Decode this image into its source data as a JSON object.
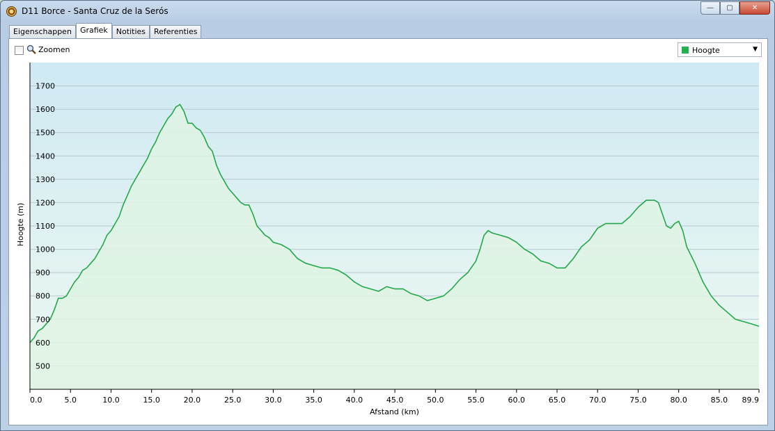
{
  "window": {
    "title": "D11 Borce - Santa Cruz de la Serós"
  },
  "window_buttons": {
    "minimize": "—",
    "maximize": "▢",
    "close": "✕"
  },
  "tabs": [
    {
      "label": "Eigenschappen",
      "active": false
    },
    {
      "label": "Grafiek",
      "active": true
    },
    {
      "label": "Notities",
      "active": false
    },
    {
      "label": "Referenties",
      "active": false
    }
  ],
  "toolbar": {
    "zoom_label": "Zoomen",
    "zoom_checked": false
  },
  "series_select": {
    "value": "Hoogte",
    "swatch_color": "#22b14c"
  },
  "colors": {
    "line": "#22a848",
    "fill": "#dff3e4",
    "bg_top": "#cfe9f3",
    "bg_bottom": "#eef9f1"
  },
  "chart_data": {
    "type": "area",
    "xlabel": "Afstand  (km)",
    "ylabel": "Hoogte (m)",
    "xlim": [
      0,
      89.9
    ],
    "ylim": [
      400,
      1800
    ],
    "x_ticks": [
      "0.0",
      "5.0",
      "10.0",
      "15.0",
      "20.0",
      "25.0",
      "30.0",
      "35.0",
      "40.0",
      "45.0",
      "50.0",
      "55.0",
      "60.0",
      "65.0",
      "70.0",
      "75.0",
      "80.0",
      "85.0",
      "89.9"
    ],
    "y_ticks": [
      "500",
      "600",
      "700",
      "800",
      "900",
      "1000",
      "1100",
      "1200",
      "1300",
      "1400",
      "1500",
      "1600",
      "1700"
    ],
    "grid": true,
    "series": [
      {
        "name": "Hoogte",
        "x": [
          0,
          0.5,
          1,
          1.5,
          2,
          2.5,
          3,
          3.5,
          4,
          4.5,
          5,
          5.5,
          6,
          6.5,
          7,
          7.5,
          8,
          8.5,
          9,
          9.5,
          10,
          10.5,
          11,
          11.5,
          12,
          12.5,
          13,
          13.5,
          14,
          14.5,
          15,
          15.5,
          16,
          16.5,
          17,
          17.5,
          18,
          18.5,
          19,
          19.2,
          19.5,
          20,
          20.5,
          21,
          21.5,
          22,
          22.5,
          23,
          23.5,
          24,
          24.5,
          25,
          25.5,
          26,
          26.5,
          27,
          27.5,
          28,
          28.5,
          29,
          29.5,
          30,
          31,
          32,
          33,
          33.5,
          34,
          35,
          36,
          37,
          38,
          39,
          40,
          41,
          42,
          43,
          44,
          45,
          46,
          47,
          48,
          49,
          50,
          51,
          52,
          53,
          54,
          55,
          55.5,
          56,
          56.5,
          57,
          58,
          59,
          60,
          61,
          62,
          63,
          64,
          65,
          66,
          67,
          68,
          69,
          70,
          71,
          72,
          73,
          74,
          75,
          76,
          77,
          77.5,
          78,
          78.5,
          79,
          79.5,
          80,
          80.5,
          81,
          82,
          83,
          84,
          85,
          86,
          87,
          88,
          89,
          89.9
        ],
        "y": [
          600,
          620,
          650,
          660,
          680,
          700,
          740,
          790,
          790,
          800,
          830,
          860,
          880,
          910,
          920,
          940,
          960,
          990,
          1020,
          1060,
          1080,
          1110,
          1140,
          1190,
          1230,
          1270,
          1300,
          1330,
          1360,
          1390,
          1430,
          1460,
          1500,
          1530,
          1560,
          1580,
          1610,
          1620,
          1590,
          1570,
          1540,
          1540,
          1520,
          1510,
          1480,
          1440,
          1420,
          1360,
          1320,
          1290,
          1260,
          1240,
          1220,
          1200,
          1190,
          1190,
          1150,
          1100,
          1080,
          1060,
          1050,
          1030,
          1020,
          1000,
          960,
          950,
          940,
          930,
          920,
          920,
          910,
          890,
          860,
          840,
          830,
          820,
          840,
          830,
          830,
          810,
          800,
          780,
          790,
          800,
          830,
          870,
          900,
          950,
          1000,
          1060,
          1080,
          1070,
          1060,
          1050,
          1030,
          1000,
          980,
          950,
          940,
          920,
          920,
          960,
          1010,
          1040,
          1090,
          1110,
          1110,
          1110,
          1140,
          1180,
          1210,
          1210,
          1200,
          1150,
          1100,
          1090,
          1110,
          1120,
          1080,
          1010,
          940,
          860,
          800,
          760,
          730,
          700,
          690,
          680,
          670
        ]
      }
    ]
  }
}
